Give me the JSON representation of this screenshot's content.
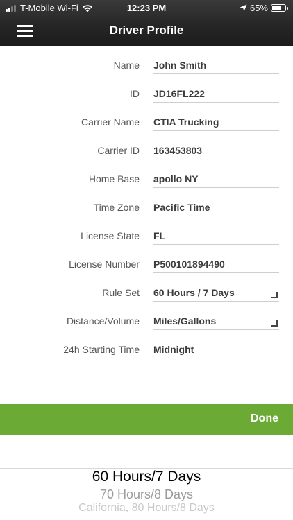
{
  "status_bar": {
    "carrier": "T-Mobile Wi-Fi",
    "time": "12:23 PM",
    "battery_percent": "65%",
    "battery_level": 0.65,
    "signal_bars_filled": 2,
    "signal_bars_total": 4
  },
  "nav": {
    "title": "Driver Profile",
    "menu_icon": "hamburger-menu-icon"
  },
  "profile": {
    "fields": [
      {
        "label": "Name",
        "value": "John Smith"
      },
      {
        "label": "ID",
        "value": "JD16FL222"
      },
      {
        "label": "Carrier Name",
        "value": "CTIA Trucking"
      },
      {
        "label": "Carrier ID",
        "value": "163453803"
      },
      {
        "label": "Home Base",
        "value": "apollo NY"
      },
      {
        "label": "Time Zone",
        "value": "Pacific Time"
      },
      {
        "label": "License State",
        "value": "FL"
      },
      {
        "label": "License Number",
        "value": "P500101894490"
      },
      {
        "label": "Rule Set",
        "value": "60 Hours / 7 Days",
        "dropdown_icon": "dropdown-corner-icon"
      },
      {
        "label": "Distance/Volume",
        "value": "Miles/Gallons",
        "dropdown_icon": "dropdown-corner-icon"
      },
      {
        "label": "24h Starting Time",
        "value": "Midnight"
      }
    ]
  },
  "done": {
    "label": "Done"
  },
  "picker": {
    "options": [
      "60 Hours/7 Days",
      "70 Hours/8 Days",
      "California, 80 Hours/8 Days"
    ],
    "selected_index": 0
  },
  "colors": {
    "header_bg": "#262626",
    "accent_green": "#6aaa35",
    "label_text": "#555555",
    "value_text": "#3c3c3c"
  }
}
